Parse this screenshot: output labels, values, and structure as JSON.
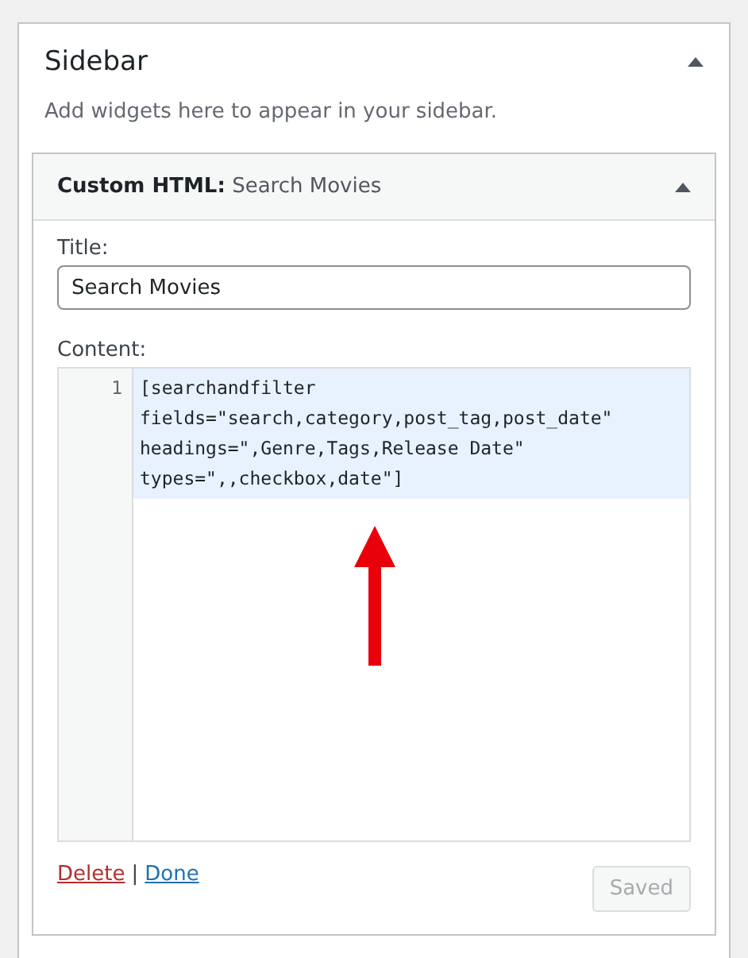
{
  "sidebar": {
    "title": "Sidebar",
    "expanded": true,
    "description": "Add widgets here to appear in your sidebar."
  },
  "widget": {
    "type_label": "Custom HTML:",
    "title": "Search Movies",
    "expanded": true,
    "title_field": {
      "label": "Title:",
      "value": "Search Movies"
    },
    "content_field": {
      "label": "Content:",
      "lines": [
        {
          "number": "1",
          "text": "[searchandfilter fields=\"search,category,post_tag,post_date\" headings=\",Genre,Tags,Release Date\" types=\",,checkbox,date\"]",
          "selected": true
        }
      ]
    },
    "actions": {
      "delete": "Delete",
      "separator": "|",
      "done": "Done"
    },
    "save_button": {
      "label": "Saved",
      "disabled": true
    }
  }
}
